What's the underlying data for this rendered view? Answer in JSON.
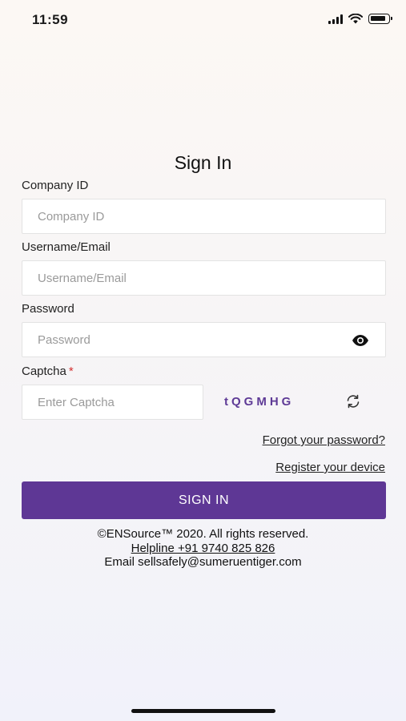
{
  "status_bar": {
    "time": "11:59"
  },
  "title": "Sign In",
  "company_id": {
    "label": "Company ID",
    "placeholder": "Company ID",
    "value": ""
  },
  "username": {
    "label": "Username/Email",
    "placeholder": "Username/Email",
    "value": ""
  },
  "password": {
    "label": "Password",
    "placeholder": "Password",
    "value": ""
  },
  "captcha": {
    "label": "Captcha",
    "required_mark": "*",
    "placeholder": "Enter Captcha",
    "value": "",
    "code": "tQGMHG"
  },
  "links": {
    "forgot_password": "Forgot your password?",
    "register_device": "Register your device"
  },
  "signin_button": "SIGN IN",
  "footer": {
    "copyright": "©ENSource™ 2020. All rights reserved.",
    "helpline": "Helpline +91 9740 825 826",
    "email": "Email sellsafely@sumeruentiger.com"
  },
  "colors": {
    "accent": "#5e3795",
    "captcha_text": "#5e3a96",
    "required": "#d32f2f"
  },
  "icons": [
    "signal-icon",
    "wifi-icon",
    "battery-icon",
    "eye-icon",
    "refresh-icon"
  ]
}
